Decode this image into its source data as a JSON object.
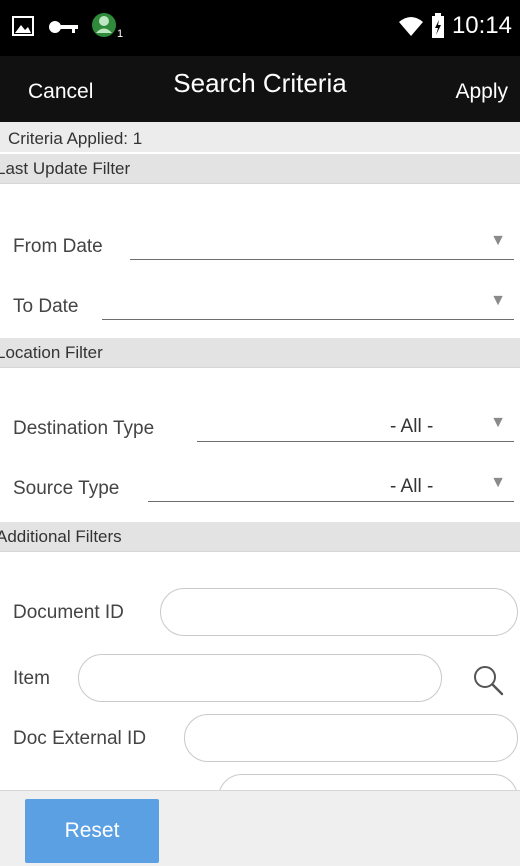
{
  "status_bar": {
    "time": "10:14",
    "icons": [
      "image-icon",
      "key-icon",
      "user-badge-icon",
      "wifi-icon",
      "battery-icon"
    ],
    "notification_count": "1"
  },
  "header": {
    "cancel_label": "Cancel",
    "title": "Search Criteria",
    "apply_label": "Apply"
  },
  "criteria_applied": "Criteria Applied: 1",
  "sections": {
    "last_update": {
      "title": "Last Update Filter",
      "from_date_label": "From Date",
      "to_date_label": "To Date"
    },
    "location": {
      "title": "Location Filter",
      "destination_type_label": "Destination Type",
      "destination_type_value": "- All -",
      "source_type_label": "Source Type",
      "source_type_value": "- All -"
    },
    "additional": {
      "title": "Additional Filters",
      "document_id_label": "Document ID",
      "item_label": "Item",
      "doc_external_id_label": "Doc External ID"
    }
  },
  "footer": {
    "reset_label": "Reset"
  },
  "colors": {
    "header_bg": "#111111",
    "section_bg": "#e3e3e3",
    "accent": "#5aa0e3"
  }
}
